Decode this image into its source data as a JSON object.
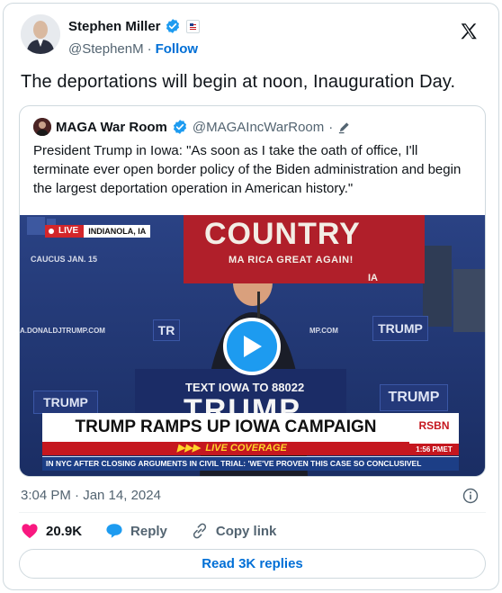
{
  "author": {
    "name": "Stephen Miller",
    "handle": "@StephenM",
    "separator": "·",
    "follow_label": "Follow",
    "verified_icon": "verified-badge-icon",
    "affiliation_icon": "affiliation-flag-icon"
  },
  "tweet_text": "The deportations will begin at noon, Inauguration Day.",
  "quoted": {
    "name": "MAGA War Room",
    "handle": "@MAGAIncWarRoom",
    "separator": "·",
    "text": "President Trump in Iowa: \"As soon as I take the oath of office, I'll terminate ever open border policy of the Biden administration and begin the largest deportation operation in American history.\"",
    "media": {
      "live_label": "LIVE",
      "location": "INDIANOLA, IA",
      "caucus": "CAUCUS JAN. 15",
      "site_left": "A.DONALDJTRUMP.COM",
      "site_right": "MP.COM",
      "banner_main": "COUNTRY",
      "banner_sub": "MA     RICA GREAT AGAIN!",
      "banner_ia": "IA",
      "sign_a": "TR",
      "sign_b": "TRUMP",
      "sign_c": "TRUMP",
      "sign_d": "TRUMP",
      "text_line": "TEXT IOWA TO 88022",
      "podium_big": "TRUMP",
      "lower_title": "TRUMP RAMPS UP IOWA CAMPAIGN",
      "lower_sub": "LIVE COVERAGE",
      "rsbn": "RSBN",
      "rsbn_time": "1:56 PMET",
      "ticker": "IN NYC AFTER CLOSING ARGUMENTS IN CIVIL TRIAL: 'WE'VE PROVEN THIS CASE SO CONCLUSIVEL"
    }
  },
  "timestamp": "3:04 PM · Jan 14, 2024",
  "actions": {
    "like_count": "20.9K",
    "reply_label": "Reply",
    "copy_label": "Copy link"
  },
  "read_replies_label": "Read 3K replies",
  "colors": {
    "accent": "#1d9bf0",
    "link": "#006fd6",
    "like": "#f91880",
    "muted": "#536471"
  }
}
